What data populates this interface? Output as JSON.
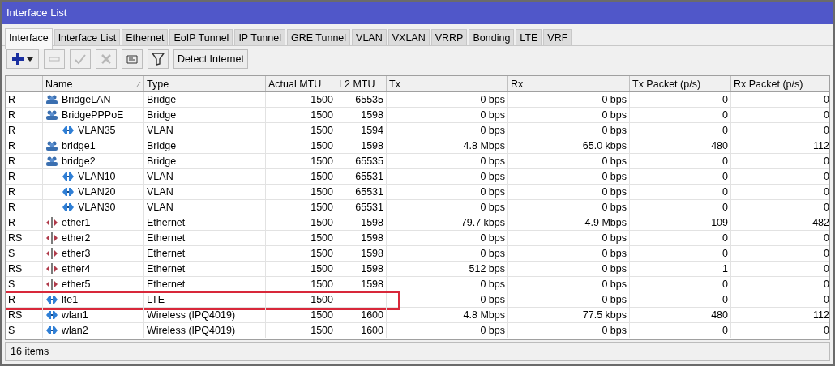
{
  "window": {
    "title": "Interface List"
  },
  "tabs": [
    {
      "label": "Interface",
      "selected": true
    },
    {
      "label": "Interface List",
      "selected": false
    },
    {
      "label": "Ethernet",
      "selected": false
    },
    {
      "label": "EoIP Tunnel",
      "selected": false
    },
    {
      "label": "IP Tunnel",
      "selected": false
    },
    {
      "label": "GRE Tunnel",
      "selected": false
    },
    {
      "label": "VLAN",
      "selected": false
    },
    {
      "label": "VXLAN",
      "selected": false
    },
    {
      "label": "VRRP",
      "selected": false
    },
    {
      "label": "Bonding",
      "selected": false
    },
    {
      "label": "LTE",
      "selected": false
    },
    {
      "label": "VRF",
      "selected": false
    }
  ],
  "toolbar": [
    {
      "kind": "add",
      "disabled": false
    },
    {
      "kind": "remove",
      "disabled": true
    },
    {
      "kind": "enable",
      "disabled": true
    },
    {
      "kind": "disable",
      "disabled": true
    },
    {
      "kind": "comment",
      "disabled": false
    },
    {
      "kind": "filter",
      "disabled": false
    },
    {
      "kind": "text",
      "label": "Detect Internet",
      "disabled": false
    }
  ],
  "table": {
    "columns": [
      "",
      "Name",
      "Type",
      "Actual MTU",
      "L2 MTU",
      "Tx",
      "Rx",
      "Tx Packet (p/s)",
      "Rx Packet (p/s)"
    ],
    "rows": [
      {
        "flags": "R",
        "name": "BridgeLAN",
        "kind": "bridge",
        "type": "Bridge",
        "actual_mtu": "1500",
        "l2_mtu": "65535",
        "tx": "0 bps",
        "rx": "0 bps",
        "tx_packet": "0",
        "rx_packet": "0",
        "highlighted": false
      },
      {
        "flags": "R",
        "name": "BridgePPPoE",
        "kind": "bridge",
        "type": "Bridge",
        "actual_mtu": "1500",
        "l2_mtu": "1598",
        "tx": "0 bps",
        "rx": "0 bps",
        "tx_packet": "0",
        "rx_packet": "0",
        "highlighted": false,
        "children": [
          {
            "flags": "R",
            "name": "VLAN35",
            "kind": "vlan",
            "type": "VLAN",
            "actual_mtu": "1500",
            "l2_mtu": "1594",
            "tx": "0 bps",
            "rx": "0 bps",
            "tx_packet": "0",
            "rx_packet": "0",
            "highlighted": false
          }
        ]
      },
      {
        "flags": "R",
        "name": "bridge1",
        "kind": "bridge",
        "type": "Bridge",
        "actual_mtu": "1500",
        "l2_mtu": "1598",
        "tx": "4.8 Mbps",
        "rx": "65.0 kbps",
        "tx_packet": "480",
        "rx_packet": "112",
        "highlighted": false
      },
      {
        "flags": "R",
        "name": "bridge2",
        "kind": "bridge",
        "type": "Bridge",
        "actual_mtu": "1500",
        "l2_mtu": "65535",
        "tx": "0 bps",
        "rx": "0 bps",
        "tx_packet": "0",
        "rx_packet": "0",
        "highlighted": false,
        "children": [
          {
            "flags": "R",
            "name": "VLAN10",
            "kind": "vlan",
            "type": "VLAN",
            "actual_mtu": "1500",
            "l2_mtu": "65531",
            "tx": "0 bps",
            "rx": "0 bps",
            "tx_packet": "0",
            "rx_packet": "0",
            "highlighted": false
          },
          {
            "flags": "R",
            "name": "VLAN20",
            "kind": "vlan",
            "type": "VLAN",
            "actual_mtu": "1500",
            "l2_mtu": "65531",
            "tx": "0 bps",
            "rx": "0 bps",
            "tx_packet": "0",
            "rx_packet": "0",
            "highlighted": false
          },
          {
            "flags": "R",
            "name": "VLAN30",
            "kind": "vlan",
            "type": "VLAN",
            "actual_mtu": "1500",
            "l2_mtu": "65531",
            "tx": "0 bps",
            "rx": "0 bps",
            "tx_packet": "0",
            "rx_packet": "0",
            "highlighted": false
          }
        ]
      },
      {
        "flags": "R",
        "name": "ether1",
        "kind": "ethernet",
        "type": "Ethernet",
        "actual_mtu": "1500",
        "l2_mtu": "1598",
        "tx": "79.7 kbps",
        "rx": "4.9 Mbps",
        "tx_packet": "109",
        "rx_packet": "482",
        "highlighted": false
      },
      {
        "flags": "RS",
        "name": "ether2",
        "kind": "ethernet",
        "type": "Ethernet",
        "actual_mtu": "1500",
        "l2_mtu": "1598",
        "tx": "0 bps",
        "rx": "0 bps",
        "tx_packet": "0",
        "rx_packet": "0",
        "highlighted": false
      },
      {
        "flags": "S",
        "name": "ether3",
        "kind": "ethernet",
        "type": "Ethernet",
        "actual_mtu": "1500",
        "l2_mtu": "1598",
        "tx": "0 bps",
        "rx": "0 bps",
        "tx_packet": "0",
        "rx_packet": "0",
        "highlighted": false
      },
      {
        "flags": "RS",
        "name": "ether4",
        "kind": "ethernet",
        "type": "Ethernet",
        "actual_mtu": "1500",
        "l2_mtu": "1598",
        "tx": "512 bps",
        "rx": "0 bps",
        "tx_packet": "1",
        "rx_packet": "0",
        "highlighted": false
      },
      {
        "flags": "S",
        "name": "ether5",
        "kind": "ethernet",
        "type": "Ethernet",
        "actual_mtu": "1500",
        "l2_mtu": "1598",
        "tx": "0 bps",
        "rx": "0 bps",
        "tx_packet": "0",
        "rx_packet": "0",
        "highlighted": false
      },
      {
        "flags": "R",
        "name": "lte1",
        "kind": "wireless",
        "type": "LTE",
        "actual_mtu": "1500",
        "tx": "0 bps",
        "rx": "0 bps",
        "tx_packet": "0",
        "rx_packet": "0",
        "highlighted": true
      },
      {
        "flags": "RS",
        "name": "wlan1",
        "kind": "wireless",
        "type": "Wireless (IPQ4019)",
        "actual_mtu": "1500",
        "l2_mtu": "1600",
        "tx": "4.8 Mbps",
        "rx": "77.5 kbps",
        "tx_packet": "480",
        "rx_packet": "112",
        "highlighted": false
      },
      {
        "flags": "S",
        "name": "wlan2",
        "kind": "wireless",
        "type": "Wireless (IPQ4019)",
        "actual_mtu": "1500",
        "l2_mtu": "1600",
        "tx": "0 bps",
        "rx": "0 bps",
        "tx_packet": "0",
        "rx_packet": "0",
        "highlighted": false
      }
    ]
  },
  "status_bar": "16 items"
}
